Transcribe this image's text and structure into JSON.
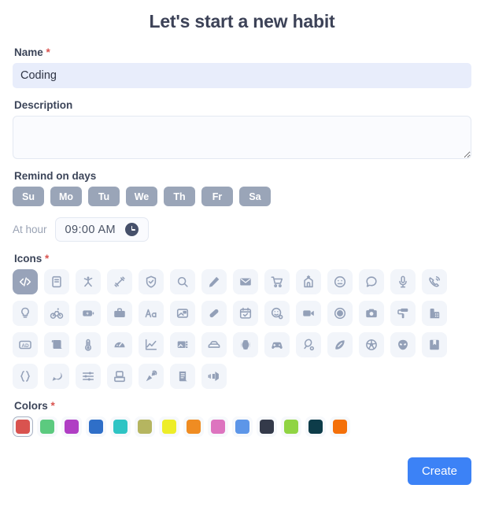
{
  "title": "Let's start a new habit",
  "name_field": {
    "label": "Name",
    "required": "*",
    "value": "Coding",
    "placeholder": ""
  },
  "description_field": {
    "label": "Description",
    "value": "",
    "placeholder": ""
  },
  "remind_on_days": {
    "label": "Remind on days",
    "days": [
      {
        "label": "Su"
      },
      {
        "label": "Mo"
      },
      {
        "label": "Tu"
      },
      {
        "label": "We"
      },
      {
        "label": "Th"
      },
      {
        "label": "Fr"
      },
      {
        "label": "Sa"
      }
    ]
  },
  "at_hour": {
    "label": "At hour",
    "value": "09:00 AM",
    "icon": "clock-icon"
  },
  "icons_field": {
    "label": "Icons",
    "required": "*",
    "selected_index": 0,
    "icons": [
      {
        "name": "code-icon"
      },
      {
        "name": "book-icon"
      },
      {
        "name": "yoga-person-icon"
      },
      {
        "name": "dumbbell-icon"
      },
      {
        "name": "shield-check-icon"
      },
      {
        "name": "search-icon"
      },
      {
        "name": "pencil-icon"
      },
      {
        "name": "envelope-icon"
      },
      {
        "name": "shopping-cart-icon"
      },
      {
        "name": "church-icon"
      },
      {
        "name": "smiley-icon"
      },
      {
        "name": "chat-bubble-icon"
      },
      {
        "name": "microphone-icon"
      },
      {
        "name": "phone-ring-icon"
      },
      {
        "name": "lightbulb-icon"
      },
      {
        "name": "bicycle-icon"
      },
      {
        "name": "battery-charging-icon"
      },
      {
        "name": "briefcase-icon"
      },
      {
        "name": "text-size-icon"
      },
      {
        "name": "image-icon"
      },
      {
        "name": "pill-icon"
      },
      {
        "name": "calendar-check-icon"
      },
      {
        "name": "smiley-search-icon"
      },
      {
        "name": "video-camera-icon"
      },
      {
        "name": "record-circle-icon"
      },
      {
        "name": "camera-icon"
      },
      {
        "name": "paint-roller-icon"
      },
      {
        "name": "factory-icon"
      },
      {
        "name": "ad-badge-icon"
      },
      {
        "name": "banner-icon"
      },
      {
        "name": "thermometer-icon"
      },
      {
        "name": "gauge-icon"
      },
      {
        "name": "line-chart-icon"
      },
      {
        "name": "photo-gallery-icon"
      },
      {
        "name": "car-icon"
      },
      {
        "name": "baseball-icon"
      },
      {
        "name": "gamepad-icon"
      },
      {
        "name": "tennis-racket-icon"
      },
      {
        "name": "football-icon"
      },
      {
        "name": "soccer-ball-icon"
      },
      {
        "name": "alien-icon"
      },
      {
        "name": "bookmark-book-icon"
      },
      {
        "name": "braces-icon"
      },
      {
        "name": "ink-drop-icon"
      },
      {
        "name": "sliders-icon"
      },
      {
        "name": "print-fold-icon"
      },
      {
        "name": "confetti-icon"
      },
      {
        "name": "scroll-icon"
      },
      {
        "name": "megaphone-icon"
      }
    ]
  },
  "colors_field": {
    "label": "Colors",
    "required": "*",
    "selected_index": 0,
    "colors": [
      {
        "name": "red",
        "hex": "#d9534f"
      },
      {
        "name": "green",
        "hex": "#5cca7f"
      },
      {
        "name": "purple",
        "hex": "#b03ec4"
      },
      {
        "name": "blue",
        "hex": "#2f6fc8"
      },
      {
        "name": "teal",
        "hex": "#2ec4c4"
      },
      {
        "name": "olive",
        "hex": "#b5b560"
      },
      {
        "name": "yellow",
        "hex": "#eded28"
      },
      {
        "name": "orange",
        "hex": "#ef8c22"
      },
      {
        "name": "pink",
        "hex": "#dd74bf"
      },
      {
        "name": "light-blue",
        "hex": "#5d96e8"
      },
      {
        "name": "dark-navy",
        "hex": "#343a4a"
      },
      {
        "name": "lime",
        "hex": "#90d444"
      },
      {
        "name": "dark-teal",
        "hex": "#0d3c49"
      },
      {
        "name": "bright-orange",
        "hex": "#f4700a"
      }
    ]
  },
  "create_button": {
    "label": "Create",
    "color": "#3c82f6"
  }
}
